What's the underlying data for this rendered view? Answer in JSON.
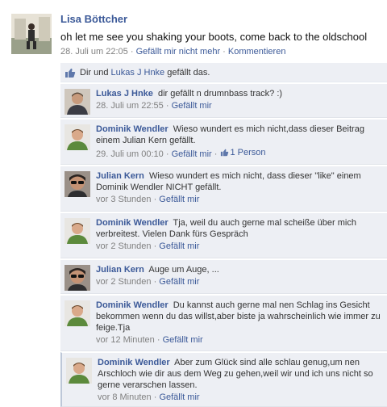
{
  "post": {
    "author": "Lisa Böttcher",
    "text": "oh let me see you shaking your boots, come back to the oldschool",
    "timestamp": "28. Juli um 22:05",
    "unlike_label": "Gefällt mir nicht mehr",
    "comment_label": "Kommentieren"
  },
  "likes": {
    "prefix": "Dir und",
    "person": "Lukas J Hnke",
    "suffix": "gefällt das."
  },
  "comments": [
    {
      "author": "Lukas J Hnke",
      "text": "dir gefällt n drumnbass track? :)",
      "time": "28. Juli um 22:55",
      "like_label": "Gefällt mir"
    },
    {
      "author": "Dominik Wendler",
      "text": "Wieso wundert es mich nicht,dass dieser Beitrag einem Julian Kern gefällt.",
      "time": "29. Juli um 00:10",
      "like_label": "Gefällt mir",
      "likes": "1 Person"
    },
    {
      "author": "Julian Kern",
      "text": "Wieso wundert es mich nicht, dass dieser \"like\" einem Dominik Wendler NICHT gefällt.",
      "time": "vor 3 Stunden",
      "like_label": "Gefällt mir"
    },
    {
      "author": "Dominik Wendler",
      "text": "Tja, weil du auch gerne mal scheiße über mich verbreitest. Vielen Dank fürs Gespräch",
      "time": "vor 2 Stunden",
      "like_label": "Gefällt mir"
    },
    {
      "author": "Julian Kern",
      "text": "Auge um Auge, ...",
      "time": "vor 2 Stunden",
      "like_label": "Gefällt mir"
    },
    {
      "author": "Dominik Wendler",
      "text": "Du kannst auch gerne mal nen Schlag ins Gesicht bekommen wenn du das willst,aber biste ja wahrscheinlich wie immer zu feige.Tja",
      "time": "vor 12 Minuten",
      "like_label": "Gefällt mir"
    },
    {
      "author": "Dominik Wendler",
      "text": "Aber zum Glück sind alle schlau genug,um nen Arschloch wie dir aus dem Weg zu gehen,weil wir und ich uns nicht so gerne verarschen lassen.",
      "time": "vor 8 Minuten",
      "like_label": "Gefällt mir"
    }
  ],
  "separator": "·",
  "colors": {
    "link": "#3b5998",
    "feedback_bg": "#edeff4",
    "meta": "#808080"
  },
  "icons": {
    "like": "thumbs-up-icon"
  }
}
